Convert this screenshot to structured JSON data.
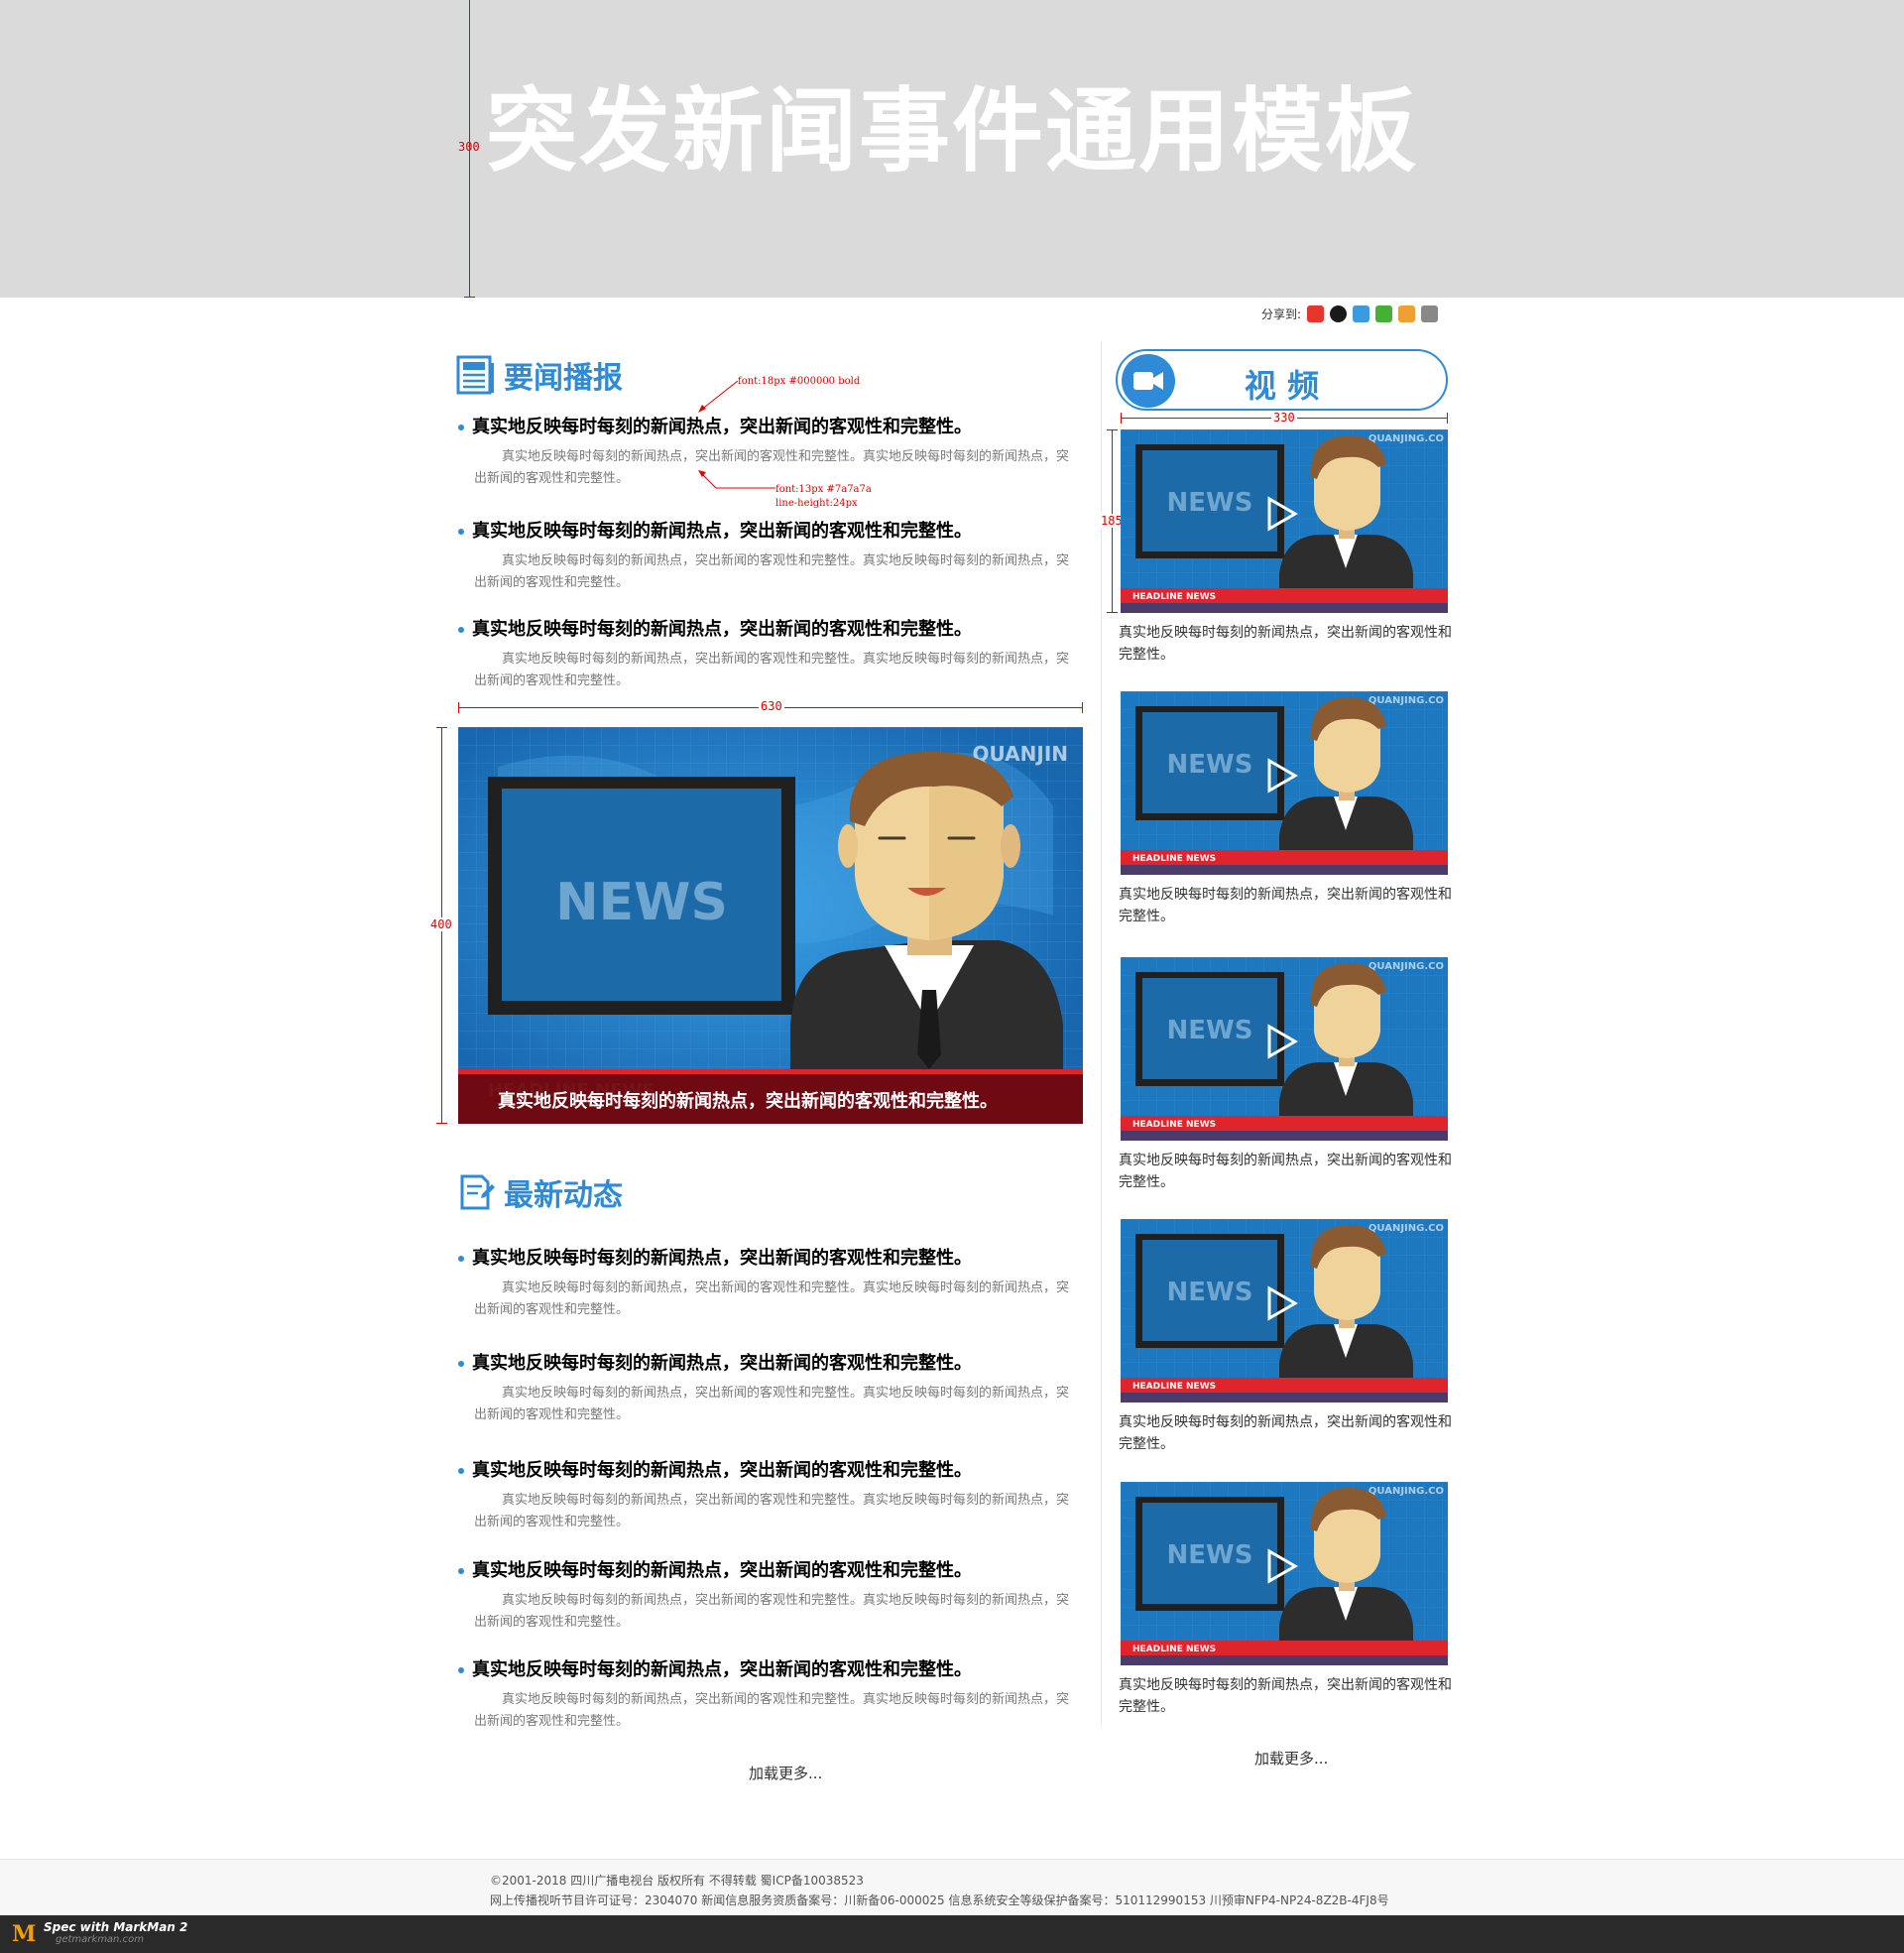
{
  "banner": {
    "title": "突发新闻事件通用模板"
  },
  "spec": {
    "banner_height": "300",
    "title_note": "font:18px #000000 bold",
    "body_note_line1": "font:13px #7a7a7a",
    "body_note_line2": "line-height:24px",
    "content_width": "630",
    "hero_height": "400",
    "video_width": "330",
    "thumb_height": "185"
  },
  "share": {
    "label": "分享到:",
    "icons": [
      "weibo-icon",
      "qq-icon",
      "qzone-icon",
      "wechat-icon",
      "tencent-weibo-icon",
      "more-share-icon"
    ],
    "colors": [
      "#e6362c",
      "#1a1a1a",
      "#3b9be0",
      "#45b035",
      "#f0a030",
      "#888888"
    ]
  },
  "headlines": {
    "title": "要闻播报",
    "articles": [
      {
        "title": "真实地反映每时每刻的新闻热点，突出新闻的客观性和完整性。",
        "body": "真实地反映每时每刻的新闻热点，突出新闻的客观性和完整性。真实地反映每时每刻的新闻热点，突出新闻的客观性和完整性。"
      },
      {
        "title": "真实地反映每时每刻的新闻热点，突出新闻的客观性和完整性。",
        "body": "真实地反映每时每刻的新闻热点，突出新闻的客观性和完整性。真实地反映每时每刻的新闻热点，突出新闻的客观性和完整性。"
      },
      {
        "title": "真实地反映每时每刻的新闻热点，突出新闻的客观性和完整性。",
        "body": "真实地反映每时每刻的新闻热点，突出新闻的客观性和完整性。真实地反映每时每刻的新闻热点，突出新闻的客观性和完整性。"
      }
    ]
  },
  "hero": {
    "screen_text": "NEWS",
    "brand_text": "QUANJIN",
    "banner_text": "HEADLINE NEWS",
    "caption": "真实地反映每时每刻的新闻热点，突出新闻的客观性和完整性。"
  },
  "latest": {
    "title": "最新动态",
    "articles": [
      {
        "title": "真实地反映每时每刻的新闻热点，突出新闻的客观性和完整性。",
        "body": "真实地反映每时每刻的新闻热点，突出新闻的客观性和完整性。真实地反映每时每刻的新闻热点，突出新闻的客观性和完整性。"
      },
      {
        "title": "真实地反映每时每刻的新闻热点，突出新闻的客观性和完整性。",
        "body": "真实地反映每时每刻的新闻热点，突出新闻的客观性和完整性。真实地反映每时每刻的新闻热点，突出新闻的客观性和完整性。"
      },
      {
        "title": "真实地反映每时每刻的新闻热点，突出新闻的客观性和完整性。",
        "body": "真实地反映每时每刻的新闻热点，突出新闻的客观性和完整性。真实地反映每时每刻的新闻热点，突出新闻的客观性和完整性。"
      },
      {
        "title": "真实地反映每时每刻的新闻热点，突出新闻的客观性和完整性。",
        "body": "真实地反映每时每刻的新闻热点，突出新闻的客观性和完整性。真实地反映每时每刻的新闻热点，突出新闻的客观性和完整性。"
      },
      {
        "title": "真实地反映每时每刻的新闻热点，突出新闻的客观性和完整性。",
        "body": "真实地反映每时每刻的新闻热点，突出新闻的客观性和完整性。真实地反映每时每刻的新闻热点，突出新闻的客观性和完整性。"
      }
    ],
    "load_more": "加载更多..."
  },
  "video": {
    "title": "视 频",
    "thumb_screen_text": "NEWS",
    "thumb_brand_text": "QUANJING.CO",
    "thumb_banner_text": "HEADLINE NEWS",
    "items": [
      {
        "caption": "真实地反映每时每刻的新闻热点，突出新闻的客观性和完整性。"
      },
      {
        "caption": "真实地反映每时每刻的新闻热点，突出新闻的客观性和完整性。"
      },
      {
        "caption": "真实地反映每时每刻的新闻热点，突出新闻的客观性和完整性。"
      },
      {
        "caption": "真实地反映每时每刻的新闻热点，突出新闻的客观性和完整性。"
      },
      {
        "caption": "真实地反映每时每刻的新闻热点，突出新闻的客观性和完整性。"
      }
    ],
    "load_more": "加载更多..."
  },
  "footer": {
    "line1": "©2001-2018 四川广播电视台 版权所有 不得转载  蜀ICP备10038523",
    "line2": "网上传播视听节目许可证号：2304070    新闻信息服务资质备案号：川新备06-000025    信息系统安全等级保护备案号：510112990153    川预审NFP4-NP24-8Z2B-4FJ8号"
  },
  "markman": {
    "logo": "M",
    "text": "Spec with MarkMan 2",
    "sub": "getmarkman.com"
  },
  "colors": {
    "accent": "#2f8bd8",
    "banner_bg": "#dadada",
    "caption_bg": "#780000"
  }
}
